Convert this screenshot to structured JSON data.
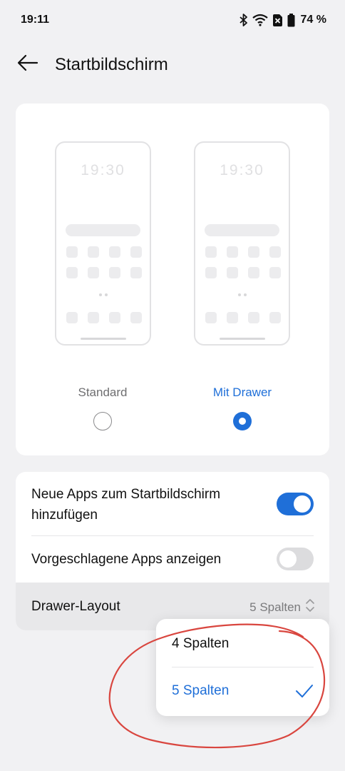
{
  "status_bar": {
    "time": "19:11",
    "battery": "74 %",
    "icons": [
      "bluetooth-icon",
      "wifi-icon",
      "no-sim-icon",
      "battery-icon"
    ]
  },
  "header": {
    "title": "Startbildschirm",
    "back_icon": "arrow-left-icon"
  },
  "preview": {
    "options": [
      {
        "label": "Standard",
        "selected": false
      },
      {
        "label": "Mit Drawer",
        "selected": true
      }
    ],
    "mock_time": "19:30"
  },
  "settings": {
    "add_new_apps": {
      "label": "Neue Apps zum Startbildschirm hinzufügen",
      "enabled": true
    },
    "suggested_apps": {
      "label": "Vorgeschlagene Apps anzeigen",
      "enabled": false
    },
    "drawer_layout": {
      "label": "Drawer-Layout",
      "value": "5 Spalten"
    }
  },
  "dropdown": {
    "options": [
      {
        "label": "4 Spalten",
        "selected": false
      },
      {
        "label": "5 Spalten",
        "selected": true
      }
    ]
  },
  "colors": {
    "accent": "#1f6fd8",
    "background": "#f1f1f3",
    "card": "#ffffff",
    "annotation": "#d9463f"
  }
}
